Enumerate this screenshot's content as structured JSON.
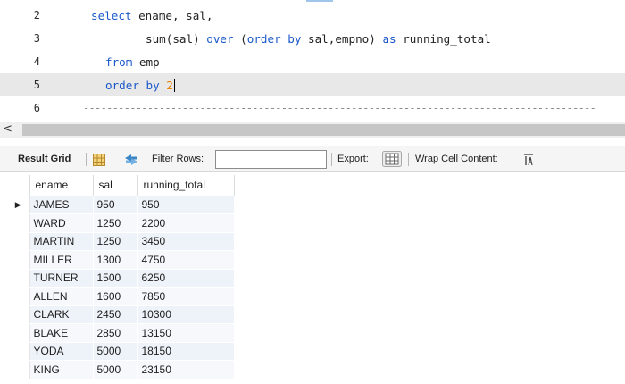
{
  "editor": {
    "lines": [
      {
        "number": "2",
        "tokens": [
          {
            "t": "kw",
            "v": "select"
          },
          {
            "t": "tx",
            "v": " ename, sal,"
          }
        ]
      },
      {
        "number": "3",
        "tokens": [
          {
            "t": "tx",
            "v": "sum(sal) "
          },
          {
            "t": "kw",
            "v": "over"
          },
          {
            "t": "tx",
            "v": " ("
          },
          {
            "t": "kw",
            "v": "order by"
          },
          {
            "t": "tx",
            "v": " sal,empno) "
          },
          {
            "t": "kw",
            "v": "as"
          },
          {
            "t": "tx",
            "v": " running_total"
          }
        ]
      },
      {
        "number": "4",
        "tokens": [
          {
            "t": "kw",
            "v": "from"
          },
          {
            "t": "tx",
            "v": " emp"
          }
        ]
      },
      {
        "number": "5",
        "tokens": [
          {
            "t": "kw",
            "v": "order by"
          },
          {
            "t": "tx",
            "v": " "
          },
          {
            "t": "num",
            "v": "2"
          }
        ]
      },
      {
        "number": "6",
        "tokens": []
      }
    ],
    "separator": "----------------------------------------------------------------------------------------"
  },
  "scrollbar": {
    "left_arrow": "<"
  },
  "toolbar": {
    "result_grid": "Result Grid",
    "filter_rows": "Filter Rows:",
    "filter_value": "",
    "export": "Export:",
    "wrap_cell_content": "Wrap Cell Content:",
    "icons": {
      "grid_view": "grid-view-icon",
      "refresh": "refresh-icon",
      "export": "export-icon",
      "wrap": "wrap-icon"
    }
  },
  "grid": {
    "columns": [
      "ename",
      "sal",
      "running_total"
    ],
    "row_marker": "▶",
    "rows": [
      [
        "JAMES",
        "950",
        "950"
      ],
      [
        "WARD",
        "1250",
        "2200"
      ],
      [
        "MARTIN",
        "1250",
        "3450"
      ],
      [
        "MILLER",
        "1300",
        "4750"
      ],
      [
        "TURNER",
        "1500",
        "6250"
      ],
      [
        "ALLEN",
        "1600",
        "7850"
      ],
      [
        "CLARK",
        "2450",
        "10300"
      ],
      [
        "BLAKE",
        "2850",
        "13150"
      ],
      [
        "YODA",
        "5000",
        "18150"
      ],
      [
        "KING",
        "5000",
        "23150"
      ]
    ]
  },
  "colors": {
    "keyword": "#1a58c9",
    "number": "#e98200",
    "current_line": "#e8e8e8"
  }
}
